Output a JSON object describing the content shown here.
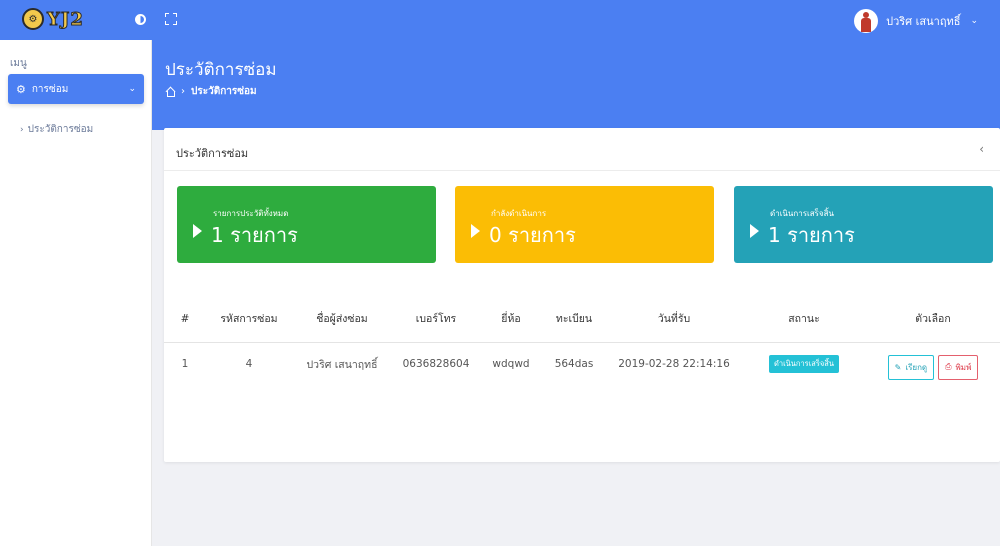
{
  "brand": {
    "name": "YJ2"
  },
  "topbar": {
    "user": {
      "name": "ปวริศ เสนาฤทธิ์"
    }
  },
  "sidebar": {
    "menu_header": "เมนู",
    "active_item": {
      "label": "การซ่อม",
      "icon": "gears-icon"
    },
    "sub_items": [
      {
        "label": "ประวัติการซ่อม"
      }
    ]
  },
  "page": {
    "title": "ประวัติการซ่อม",
    "breadcrumb": {
      "current": "ประวัติการซ่อม"
    }
  },
  "card": {
    "title": "ประวัติการซ่อม",
    "toggle": "‹"
  },
  "stats": [
    {
      "label": "รายการประวัติทั้งหมด",
      "count": "1 รายการ",
      "color": "#2eac3e"
    },
    {
      "label": "กำลังดำเนินการ",
      "count": "0 รายการ",
      "color": "#fbbd05"
    },
    {
      "label": "ดำเนินการเสร็จสิ้น",
      "count": "1 รายการ",
      "color": "#24a2b7"
    }
  ],
  "table": {
    "headers": [
      "#",
      "รหัสการซ่อม",
      "ชื่อผู้ส่งซ่อม",
      "เบอร์โทร",
      "ยี่ห้อ",
      "ทะเบียน",
      "วันที่รับ",
      "สถานะ",
      "ตัวเลือก"
    ],
    "rows": [
      {
        "no": "1",
        "repair_id": "4",
        "sender": "ปวริศ เสนาฤทธิ์",
        "phone": "0636828604",
        "brand": "wdqwd",
        "plate": "564das",
        "received": "2019-02-28 22:14:16",
        "status": "ดำเนินการเสร็จสิ้น",
        "view_label": "เรียกดู",
        "print_label": "พิมพ์"
      }
    ]
  },
  "colors": {
    "primary": "#4b7ff2",
    "green": "#2eac3e",
    "yellow": "#fbbd05",
    "teal": "#24a2b7",
    "danger": "#dc3545"
  }
}
